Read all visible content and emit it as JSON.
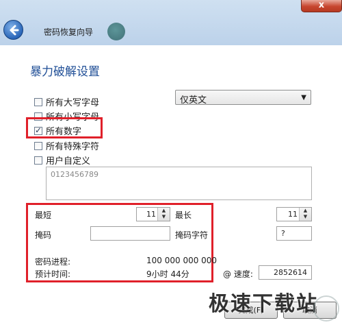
{
  "window": {
    "close_label": "x",
    "title": "密码恢复向导"
  },
  "section": {
    "title": "暴力破解设置"
  },
  "charset_options": [
    {
      "label": "所有大写字母",
      "checked": false
    },
    {
      "label": "所有小写字母",
      "checked": false
    },
    {
      "label": "所有数字",
      "checked": true
    },
    {
      "label": "所有特殊字符",
      "checked": false
    },
    {
      "label": "用户自定义",
      "checked": false
    }
  ],
  "language_select": {
    "value": "仅英文"
  },
  "custom_chars": {
    "value": "0123456789"
  },
  "settings": {
    "min_label": "最短",
    "min_value": "11",
    "max_label": "最长",
    "max_value": "11",
    "mask_label": "掩码",
    "mask_value": "",
    "mask_char_label": "掩码字符",
    "mask_char_value": "?",
    "progress_label": "密码进程:",
    "progress_value": "100 000 000 000",
    "eta_label": "预计时间:",
    "eta_value": "9小时 44分",
    "speed_label": "@ 速度:",
    "speed_value": "2852614"
  },
  "buttons": {
    "next": "完成(F)",
    "cancel": "取消"
  },
  "watermark": "极速下载站",
  "colors": {
    "highlight": "#e0202a",
    "title": "#1f4e96"
  }
}
